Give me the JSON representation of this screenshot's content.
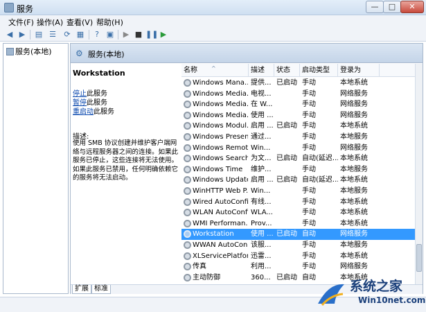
{
  "window": {
    "title": "服务",
    "min": "—",
    "max": "□",
    "close": "✕"
  },
  "menu": [
    "文件(F)",
    "操作(A)",
    "查看(V)",
    "帮助(H)"
  ],
  "tree": {
    "item": "服务(本地)"
  },
  "main_header": "服务(本地)",
  "details": {
    "title": "Workstation",
    "link_stop": "停止",
    "link_stop_suffix": "此服务",
    "link_pause": "暂停",
    "link_pause_suffix": "此服务",
    "link_restart": "重启动",
    "link_restart_suffix": "此服务",
    "desc_label": "描述:",
    "desc_text": "使用 SMB 协议创建并维护客户端网络与远程服务器之间的连接。如果此服务已停止，这些连接将无法使用。如果此服务已禁用，任何明确依赖它的服务将无法启动。"
  },
  "columns": [
    "名称",
    "描述",
    "状态",
    "启动类型",
    "登录为"
  ],
  "services": [
    {
      "name": "Windows Mana...",
      "desc": "提供...",
      "status": "已启动",
      "start": "手动",
      "logon": "本地系统"
    },
    {
      "name": "Windows Media...",
      "desc": "电视...",
      "status": "",
      "start": "手动",
      "logon": "网络服务"
    },
    {
      "name": "Windows Media...",
      "desc": "在 W...",
      "status": "",
      "start": "手动",
      "logon": "网络服务"
    },
    {
      "name": "Windows Media...",
      "desc": "使用 ...",
      "status": "",
      "start": "手动",
      "logon": "网络服务"
    },
    {
      "name": "Windows Modul...",
      "desc": "启用 ...",
      "status": "已启动",
      "start": "手动",
      "logon": "本地系统"
    },
    {
      "name": "Windows Presen...",
      "desc": "通过...",
      "status": "",
      "start": "手动",
      "logon": "本地服务"
    },
    {
      "name": "Windows Remot...",
      "desc": "Win...",
      "status": "",
      "start": "手动",
      "logon": "网络服务"
    },
    {
      "name": "Windows Search",
      "desc": "为文...",
      "status": "已启动",
      "start": "自动(延迟...",
      "logon": "本地系统"
    },
    {
      "name": "Windows Time",
      "desc": "维护...",
      "status": "",
      "start": "手动",
      "logon": "本地服务"
    },
    {
      "name": "Windows Update",
      "desc": "启用 ...",
      "status": "已启动",
      "start": "自动(延迟...",
      "logon": "本地系统"
    },
    {
      "name": "WinHTTP Web P...",
      "desc": "Win...",
      "status": "",
      "start": "手动",
      "logon": "本地服务"
    },
    {
      "name": "Wired AutoConfig",
      "desc": "有线...",
      "status": "",
      "start": "手动",
      "logon": "本地系统"
    },
    {
      "name": "WLAN AutoConfig",
      "desc": "WLA...",
      "status": "",
      "start": "手动",
      "logon": "本地系统"
    },
    {
      "name": "WMI Performan...",
      "desc": "Prov...",
      "status": "",
      "start": "手动",
      "logon": "本地系统"
    },
    {
      "name": "Workstation",
      "desc": "使用 ...",
      "status": "已启动",
      "start": "自动",
      "logon": "网络服务",
      "selected": true
    },
    {
      "name": "WWAN AutoCon...",
      "desc": "该服...",
      "status": "",
      "start": "手动",
      "logon": "本地服务"
    },
    {
      "name": "XLServicePlatform",
      "desc": "迅雷...",
      "status": "",
      "start": "手动",
      "logon": "本地系统"
    },
    {
      "name": "传真",
      "desc": "利用...",
      "status": "",
      "start": "手动",
      "logon": "网络服务"
    },
    {
      "name": "主动防御",
      "desc": "360...",
      "status": "已启动",
      "start": "自动",
      "logon": "本地系统"
    }
  ],
  "tabs": [
    "扩展",
    "标准"
  ],
  "watermark": {
    "text": "系统之家",
    "url": "Win10net.com"
  },
  "colors": {
    "selection": "#3399ff",
    "link": "#0645ad",
    "header": "#c4d4e8"
  }
}
